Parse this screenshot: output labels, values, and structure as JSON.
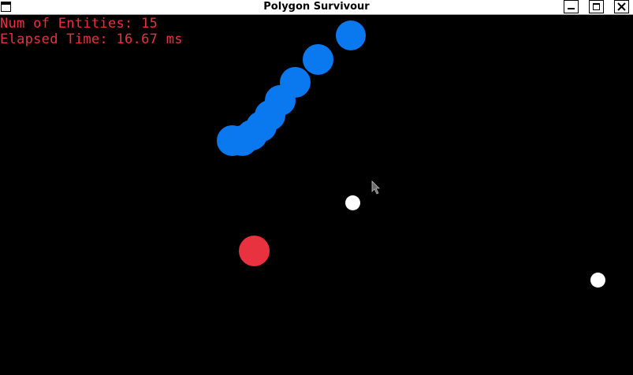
{
  "window": {
    "title": "Polygon Survivour",
    "controls": [
      "minimize",
      "maximize",
      "close"
    ]
  },
  "hud": {
    "entities_text": "Num of Entities: 15",
    "elapsed_text": "Elapsed Time: 16.67 ms"
  },
  "colors": {
    "background": "#000000",
    "hud_text": "#e8323f",
    "enemy": "#0a78ef",
    "player": "#e8323f",
    "bullet": "#ffffff"
  },
  "icons": {
    "window_menu": "window-menu-icon",
    "minimize": "minimize-icon",
    "maximize": "maximize-icon",
    "close": "close-icon",
    "cursor": "mouse-cursor-icon"
  },
  "entities": {
    "enemies": 9,
    "player": 1,
    "bullets": 2
  }
}
